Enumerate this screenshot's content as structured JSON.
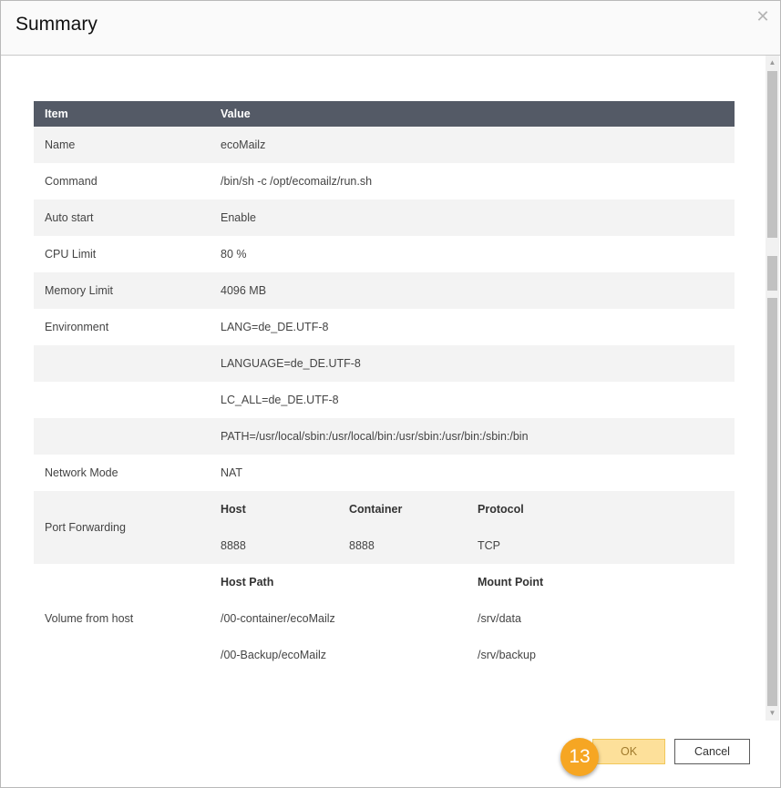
{
  "dialog": {
    "title": "Summary",
    "close_icon": "close-icon"
  },
  "table": {
    "headers": {
      "item": "Item",
      "value": "Value"
    },
    "rows": [
      {
        "item": "Name",
        "value": "ecoMailz"
      },
      {
        "item": "Command",
        "value": "/bin/sh -c /opt/ecomailz/run.sh"
      },
      {
        "item": "Auto start",
        "value": "Enable"
      },
      {
        "item": "CPU Limit",
        "value": "80 %"
      },
      {
        "item": "Memory Limit",
        "value": "4096 MB"
      },
      {
        "item": "Environment",
        "value": "LANG=de_DE.UTF-8"
      },
      {
        "item": "",
        "value": "LANGUAGE=de_DE.UTF-8"
      },
      {
        "item": "",
        "value": "LC_ALL=de_DE.UTF-8"
      },
      {
        "item": "",
        "value": "PATH=/usr/local/sbin:/usr/local/bin:/usr/sbin:/usr/bin:/sbin:/bin"
      },
      {
        "item": "Network Mode",
        "value": "NAT"
      }
    ],
    "port_forwarding": {
      "item": "Port Forwarding",
      "headers": {
        "host": "Host",
        "container": "Container",
        "protocol": "Protocol"
      },
      "row": {
        "host": "8888",
        "container": "8888",
        "protocol": "TCP"
      }
    },
    "volume": {
      "item": "Volume from host",
      "headers": {
        "host_path": "Host Path",
        "mount_point": "Mount Point"
      },
      "rows": [
        {
          "host_path": "/00-container/ecoMailz",
          "mount_point": "/srv/data"
        },
        {
          "host_path": "/00-Backup/ecoMailz",
          "mount_point": "/srv/backup"
        }
      ]
    }
  },
  "footer": {
    "ok_label": "OK",
    "cancel_label": "Cancel",
    "step_badge": "13"
  },
  "colors": {
    "header_row": "#545a66",
    "ok_button": "#fde09a",
    "step_badge": "#f6a623"
  }
}
